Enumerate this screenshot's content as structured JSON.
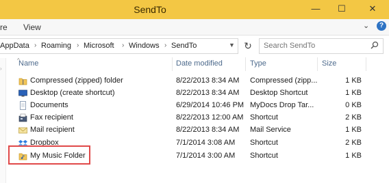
{
  "window": {
    "title": "SendTo",
    "minimize_label": "—",
    "maximize_label": "☐",
    "close_label": "✕"
  },
  "menu": {
    "items": [
      "re",
      "View"
    ]
  },
  "address": {
    "crumbs": [
      "AppData",
      "Roaming",
      "Microsoft",
      "Windows",
      "SendTo"
    ]
  },
  "search": {
    "placeholder": "Search SendTo"
  },
  "columns": {
    "name": "Name",
    "date": "Date modified",
    "type": "Type",
    "size": "Size"
  },
  "files": [
    {
      "name": "Compressed (zipped) folder",
      "date": "8/22/2013 8:34 AM",
      "type": "Compressed (zipp...",
      "size": "1 KB",
      "icon": "zip-folder-icon"
    },
    {
      "name": "Desktop (create shortcut)",
      "date": "8/22/2013 8:34 AM",
      "type": "Desktop Shortcut",
      "size": "1 KB",
      "icon": "desktop-icon"
    },
    {
      "name": "Documents",
      "date": "6/29/2014 10:46 PM",
      "type": "MyDocs Drop Tar...",
      "size": "0 KB",
      "icon": "documents-icon"
    },
    {
      "name": "Fax recipient",
      "date": "8/22/2013 12:00 AM",
      "type": "Shortcut",
      "size": "2 KB",
      "icon": "fax-icon"
    },
    {
      "name": "Mail recipient",
      "date": "8/22/2013 8:34 AM",
      "type": "Mail Service",
      "size": "1 KB",
      "icon": "mail-icon"
    },
    {
      "name": "Dropbox",
      "date": "7/1/2014 3:08 AM",
      "type": "Shortcut",
      "size": "2 KB",
      "icon": "dropbox-icon"
    },
    {
      "name": "My Music Folder",
      "date": "7/1/2014 3:00 AM",
      "type": "Shortcut",
      "size": "1 KB",
      "icon": "music-folder-icon"
    }
  ],
  "colors": {
    "titlebar": "#f3c744",
    "header_text": "#4d6a8c",
    "highlight": "#e04848"
  }
}
